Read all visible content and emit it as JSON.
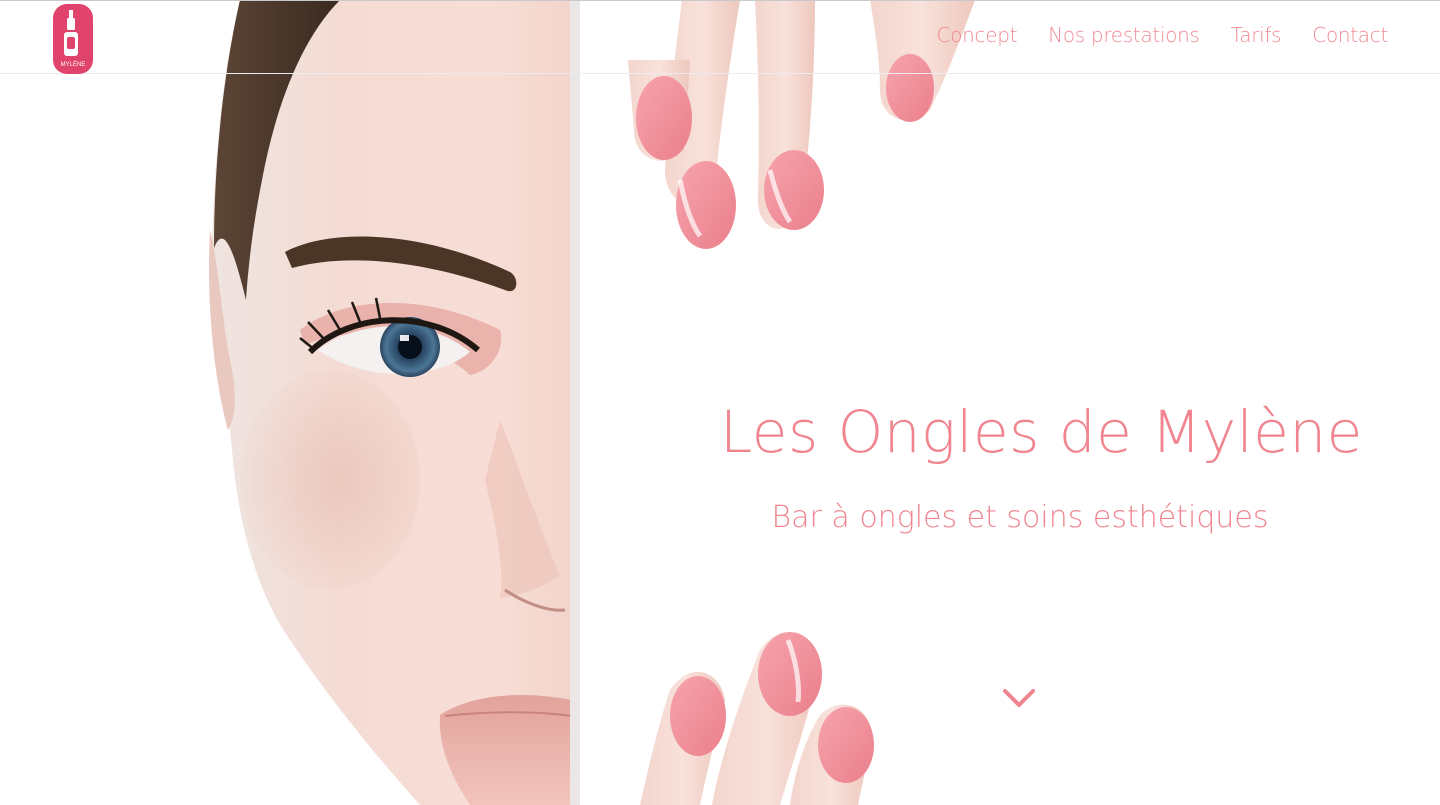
{
  "brand": {
    "logo_text": "MYLÈNE",
    "accent": "#e0436b"
  },
  "nav": {
    "items": [
      {
        "label": "Concept"
      },
      {
        "label": "Nos prestations"
      },
      {
        "label": "Tarifs"
      },
      {
        "label": "Contact"
      }
    ],
    "color": "#f08a94"
  },
  "hero": {
    "title": "Les Ongles de Mylène",
    "subtitle": "Bar à ongles et soins esthétiques",
    "text_color": "#f0858f",
    "scroll_icon": "chevron-down-icon"
  }
}
